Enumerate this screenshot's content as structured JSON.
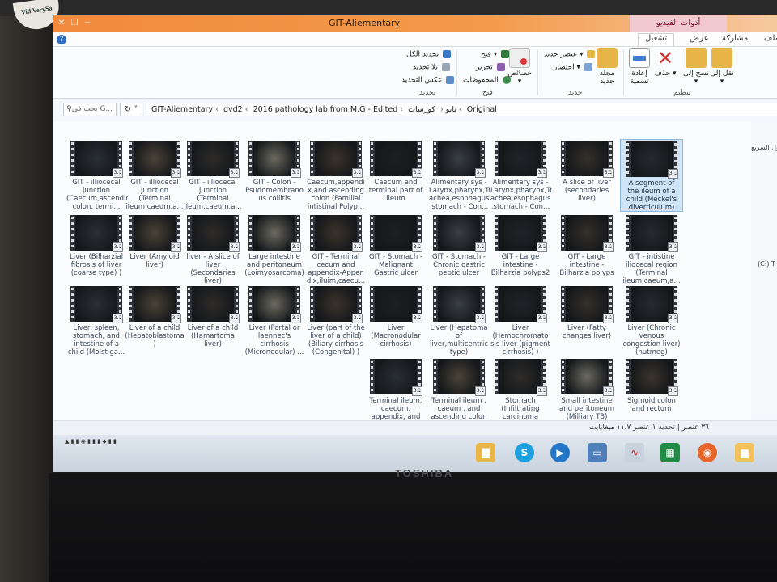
{
  "window": {
    "title": "GIT-Aliementary",
    "video_tools": "أدوات الفيديو"
  },
  "tabs": {
    "share": "مشاركة",
    "view": "عرض",
    "play": "تشغيل",
    "file": "ملف"
  },
  "ribbon": {
    "select_all": "تحديد الكل",
    "select_none": "بلا تحديد",
    "invert_selection": "عكس التحديد",
    "group_select": "تحديد",
    "open": "فتح",
    "edit": "تحرير",
    "history": "المحفوظات",
    "properties": "خصائص",
    "group_open": "فتح",
    "new_item": "عنصر جديد",
    "easy_access": "اختصار",
    "new_folder": "مجلد جديد",
    "group_new": "جديد",
    "rename": "إعادة تسمية",
    "delete": "حذف",
    "copy_to": "نسخ إلى",
    "move_to": "نقل إلى",
    "group_organize": "تنظيم"
  },
  "address": {
    "search_placeholder": "بحث في G...",
    "crumbs": [
      "GIT-Aliementary",
      "dvd2",
      "2016 pathology lab from M.G - Edited",
      "بانو",
      "كورسات",
      "Original"
    ]
  },
  "navpane": {
    "label1": "الوصول السريع",
    "label2": "(C:) T"
  },
  "files": [
    {
      "caption": "GIT - illiocecal junction (Caecum,ascending colon, termi..."
    },
    {
      "caption": "GIT - illiocecal junction (Terminal ileum,caeum,a..."
    },
    {
      "caption": "GIT - illiocecal junction (Terminal ileum,caeum,a..."
    },
    {
      "caption": "GIT - Colon - Psudomembrano us collitis"
    },
    {
      "caption": "Caecum,appendi x,and ascending colon (Familial intistinal Polyp..."
    },
    {
      "caption": "Caecum and terminal part of ileum"
    },
    {
      "caption": "Alimentary sys - Larynx,pharynx,Tr achea,esophagus ,stomach - Con..."
    },
    {
      "caption": "Alimentary sys - Larynx,pharynx,Tr achea,esophagus ,stomach - Con..."
    },
    {
      "caption": "A slice of liver (secondaries liver)"
    },
    {
      "caption": "A segment of the ileum of a child (Meckel's diverticulum)"
    },
    {
      "caption": "Liver (Bilharzial fibrosis of liver (coarse type) )"
    },
    {
      "caption": "Liver (Amyloid liver)"
    },
    {
      "caption": "liver - A slice of liver (Secondaries liver)"
    },
    {
      "caption": "Large intestine and peritoneum (Loimyosarcoma)"
    },
    {
      "caption": "GIT - Terminal cecum and appendix-Appen dix,iluim,caecu..."
    },
    {
      "caption": "GIT - Stomach - Malignant Gastric ulcer"
    },
    {
      "caption": "GIT - Stomach - Chronic gastric peptic ulcer"
    },
    {
      "caption": "GIT - Large intestine - Bilharzia polyps2"
    },
    {
      "caption": "GIT - Large intestine - Bilharzia polyps"
    },
    {
      "caption": "GIT - intistine iliocecal region (Terminal ileum,caeum,a..."
    },
    {
      "caption": "Liver, spleen, stomach, and intestine of a child (Moist ga..."
    },
    {
      "caption": "Liver of a child (Hepatoblastoma )"
    },
    {
      "caption": "Liver of a child (Hamartoma liver)"
    },
    {
      "caption": "Liver (Portal or laennec's cirrhosis (Micronodular) ..."
    },
    {
      "caption": "Liver (part of the liver of a child) (Biliary cirrhosis (Congenital) )"
    },
    {
      "caption": "Liver (Macronodular cirrhosis)"
    },
    {
      "caption": "Liver (Hepatoma of liver,multicentric type)"
    },
    {
      "caption": "Liver (Hemochromato sis liver (pigment cirrhosis) )"
    },
    {
      "caption": "Liver (Fatty changes liver)"
    },
    {
      "caption": "Liver (Chronic venous congestion liver) (nutmeg)"
    },
    {
      "caption": "Terminal ileum, caecum, appendix, and adjoing part of ..."
    },
    {
      "caption": "Terminal ileum , caeum , and ascending colon ( Fungating c..."
    },
    {
      "caption": "Stomach (Infiltrating carcinoma stomach, with s..."
    },
    {
      "caption": "Small intestine and peritoneum (Milliary TB)"
    },
    {
      "caption": "Sigmoid colon and rectum"
    }
  ],
  "file_badge": "3.1",
  "status": {
    "text": "٣٦ عنصر  |  تحديد ١ عنصر  ١١.٧ ميغابايت"
  },
  "taskbar": {
    "icons": [
      "folder-icon",
      "skype-icon",
      "media-player-icon",
      "window-icon",
      "network-icon",
      "excel-icon",
      "firefox-icon",
      "explorer-icon"
    ]
  }
}
